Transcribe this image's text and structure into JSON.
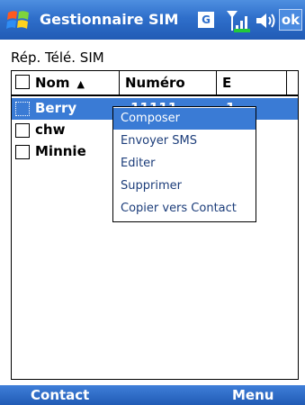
{
  "titlebar": {
    "app_title": "Gestionnaire SIM",
    "g_badge": "G",
    "ok_label": "ok"
  },
  "section_label": "Rép. Télé. SIM",
  "table": {
    "headers": {
      "name": "Nom",
      "number": "Numéro",
      "e": "E"
    },
    "sort_indicator": "▲",
    "rows": [
      {
        "name": "Berry",
        "number": "11111",
        "e": "1",
        "selected": true
      },
      {
        "name": "chw",
        "number": "",
        "e": "",
        "selected": false
      },
      {
        "name": "Minnie",
        "number": "",
        "e": "",
        "selected": false
      }
    ]
  },
  "context_menu": {
    "items": [
      "Composer",
      "Envoyer SMS",
      "Editer",
      "Supprimer",
      "Copier vers Contact"
    ],
    "highlighted_index": 0
  },
  "softkeys": {
    "left": "Contact",
    "right": "Menu"
  },
  "colors": {
    "title_bar": "#2f6fcb",
    "selection": "#3a7bd5",
    "menu_text": "#1c3d7a"
  },
  "icons": [
    "windows-start-icon",
    "signal-icon",
    "volume-icon"
  ]
}
